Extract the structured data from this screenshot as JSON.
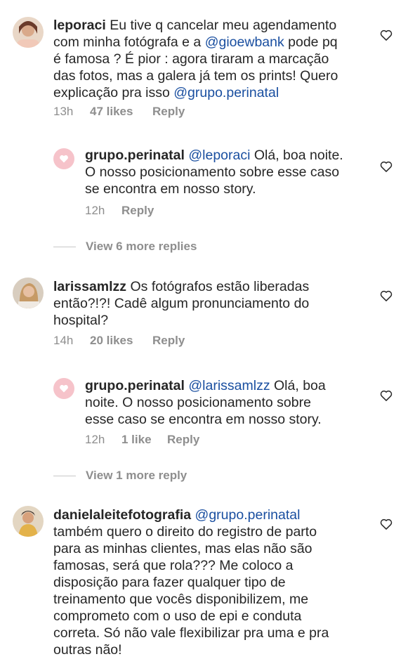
{
  "comments": [
    {
      "username": "leporaci",
      "lines": [
        [
          {
            "t": "Eu tive q cancelar meu agendamento"
          }
        ],
        [
          {
            "t": "com minha fotógrafa e a "
          },
          {
            "t": "@gioewbank",
            "m": true
          },
          {
            "t": " pode pq"
          }
        ],
        [
          {
            "t": "é famosa ? É pior : agora tiraram a marcação"
          }
        ],
        [
          {
            "t": "das fotos, mas a galera já tem os prints! Quero"
          }
        ],
        [
          {
            "t": "explicação pra isso "
          },
          {
            "t": "@grupo.perinatal",
            "m": true
          }
        ]
      ],
      "time": "13h",
      "likes": "47 likes",
      "reply": "Reply",
      "reply_item": {
        "username": "grupo.perinatal",
        "lines": [
          [
            {
              "t": "@leporaci",
              "m": true
            },
            {
              "t": " Olá, boa noite."
            }
          ],
          [
            {
              "t": "O nosso posicionamento sobre esse caso"
            }
          ],
          [
            {
              "t": "se encontra em nosso story."
            }
          ]
        ],
        "time": "12h",
        "likes": "",
        "reply": "Reply"
      },
      "view_more": "View 6 more replies"
    },
    {
      "username": "larissamlzz",
      "lines": [
        [
          {
            "t": "Os fotógrafos estão liberadas"
          }
        ],
        [
          {
            "t": "então?!?! Cadê algum pronunciamento do"
          }
        ],
        [
          {
            "t": "hospital?"
          }
        ]
      ],
      "time": "14h",
      "likes": "20 likes",
      "reply": "Reply",
      "reply_item": {
        "username": "grupo.perinatal",
        "lines": [
          [
            {
              "t": "@larissamlzz",
              "m": true
            },
            {
              "t": " Olá, boa"
            }
          ],
          [
            {
              "t": "noite. O nosso posicionamento sobre"
            }
          ],
          [
            {
              "t": "esse caso se encontra em nosso story."
            }
          ]
        ],
        "time": "12h",
        "likes": "1 like",
        "reply": "Reply"
      },
      "view_more": "View 1 more reply"
    },
    {
      "username": "danielaleitefotografia",
      "lines": [
        [
          {
            "t": "@grupo.perinatal",
            "m": true
          }
        ],
        [
          {
            "t": "também quero o direito do registro de parto"
          }
        ],
        [
          {
            "t": "para as minhas clientes, mas elas não são"
          }
        ],
        [
          {
            "t": "famosas, será que rola??? Me coloco a"
          }
        ],
        [
          {
            "t": "disposição para fazer qualquer tipo de"
          }
        ],
        [
          {
            "t": "treinamento que vocês disponibilizem, me"
          }
        ],
        [
          {
            "t": "comprometo com o uso de epi e conduta"
          }
        ],
        [
          {
            "t": "correta. Só não vale flexibilizar pra uma e pra"
          }
        ],
        [
          {
            "t": "outras não!"
          }
        ]
      ]
    }
  ],
  "colors": {
    "mention": "#1a4fa0",
    "meta": "#8e8e8e",
    "text": "#262626",
    "logo_bg": "#f6c3ca"
  }
}
